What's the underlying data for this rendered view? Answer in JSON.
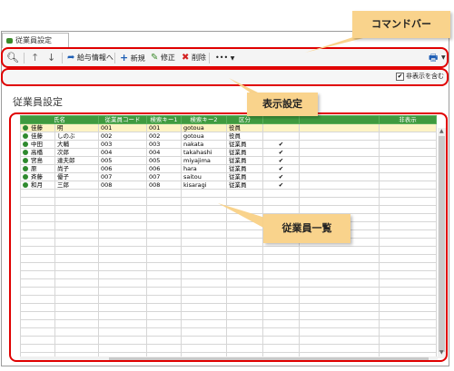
{
  "tab": {
    "label": "従業員設定"
  },
  "toolbar": {
    "pay_info_label": "給与情報へ",
    "new_label": "新規",
    "edit_label": "修正",
    "delete_label": "削除",
    "more_label": "•••"
  },
  "options": {
    "show_hidden_label": "非表示を含む",
    "show_hidden_checked": true
  },
  "page": {
    "title": "従業員設定"
  },
  "callouts": {
    "command_bar": "コマンドバー",
    "display_settings": "表示設定",
    "employee_list": "従業員一覧"
  },
  "grid": {
    "headers": [
      "氏名",
      "",
      "従業員コード",
      "検索キー1",
      "検索キー2",
      "区分",
      "",
      "",
      "非表示"
    ],
    "rows": [
      {
        "last": "佳藤",
        "first": "明",
        "code": "001",
        "key1": "001",
        "key2": "gotoua",
        "kubun": "役員",
        "check": ""
      },
      {
        "last": "佳藤",
        "first": "しのぶ",
        "code": "002",
        "key1": "002",
        "key2": "gotoua",
        "kubun": "役員",
        "check": ""
      },
      {
        "last": "中田",
        "first": "大輔",
        "code": "003",
        "key1": "003",
        "key2": "nakata",
        "kubun": "従業員",
        "check": "✔"
      },
      {
        "last": "高橋",
        "first": "次郎",
        "code": "004",
        "key1": "004",
        "key2": "takahashi",
        "kubun": "従業員",
        "check": "✔"
      },
      {
        "last": "宮島",
        "first": "達夫郎",
        "code": "005",
        "key1": "005",
        "key2": "miyajima",
        "kubun": "従業員",
        "check": "✔"
      },
      {
        "last": "原",
        "first": "尚子",
        "code": "006",
        "key1": "006",
        "key2": "hara",
        "kubun": "従業員",
        "check": "✔"
      },
      {
        "last": "斉藤",
        "first": "優子",
        "code": "007",
        "key1": "007",
        "key2": "saitou",
        "kubun": "従業員",
        "check": "✔"
      },
      {
        "last": "和月",
        "first": "三郎",
        "code": "008",
        "key1": "008",
        "key2": "kisaragi",
        "kubun": "従業員",
        "check": "✔"
      }
    ]
  },
  "colors": {
    "accent_green": "#3f9a3f",
    "highlight_red": "#e00000",
    "callout_bg": "#f9d38c"
  }
}
